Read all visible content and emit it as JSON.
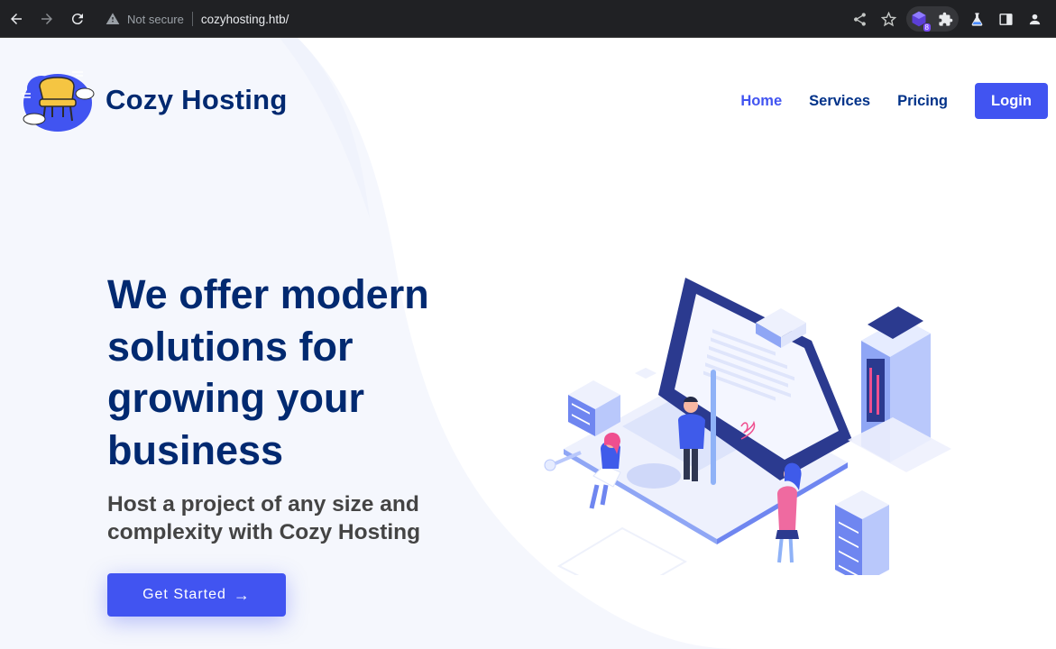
{
  "browser": {
    "security_label": "Not secure",
    "url": "cozyhosting.htb/",
    "extension_badge": "8"
  },
  "site": {
    "brand": "Cozy Hosting",
    "nav": [
      {
        "label": "Home",
        "active": true
      },
      {
        "label": "Services",
        "active": false
      },
      {
        "label": "Pricing",
        "active": false
      }
    ],
    "login_label": "Login"
  },
  "hero": {
    "title": "We offer modern solutions for growing your business",
    "subtitle": "Host a project of any size and complexity with Cozy Hosting",
    "cta_label": "Get Started",
    "cta_icon": "arrow-right-icon"
  },
  "colors": {
    "accent": "#4154f1",
    "navy": "#012970",
    "chrome": "#202124"
  }
}
